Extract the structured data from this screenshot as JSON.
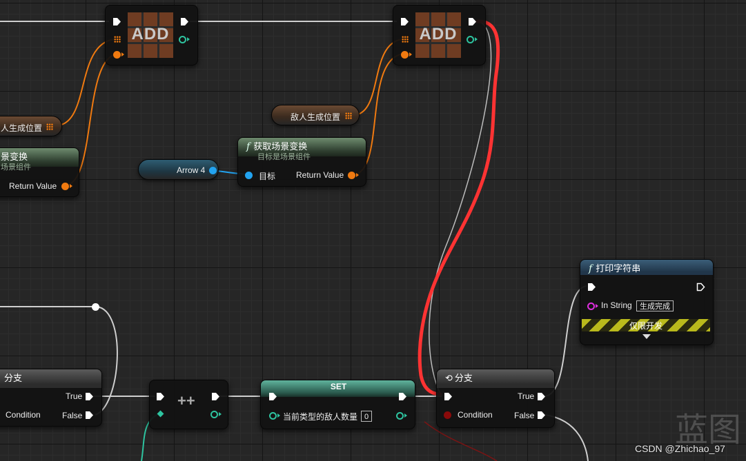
{
  "nodes": {
    "add_1": {
      "label": "ADD"
    },
    "add_2": {
      "label": "ADD"
    },
    "var_spawn_left": {
      "label": "人生成位置"
    },
    "var_spawn_right": {
      "label": "敌人生成位置"
    },
    "transform_left": {
      "title": "景变换",
      "subtitle": "场景组件",
      "output": "Return Value"
    },
    "transform_right": {
      "title": "获取场景变换",
      "subtitle": "目标是场景组件",
      "target": "目标",
      "output": "Return Value"
    },
    "arrow_var": {
      "label": "Arrow 4"
    },
    "branch_left": {
      "title": "分支",
      "condition": "Condition",
      "true_label": "True",
      "false_label": "False"
    },
    "increment": {
      "label": "++"
    },
    "set_node": {
      "title": "SET",
      "var_label": "当前类型的敌人数量",
      "value": "0"
    },
    "branch_right": {
      "title": "分支",
      "condition": "Condition",
      "true_label": "True",
      "false_label": "False"
    },
    "print_string": {
      "title": "打印字符串",
      "in_string_label": "In String",
      "in_string_value": "生成完成",
      "dev_only": "仅限开发"
    }
  },
  "watermark": {
    "text": "蓝图",
    "credit": "CSDN @Zhichao_97"
  },
  "colors": {
    "exec": "#ffffff",
    "transform": "#f07a10",
    "object": "#22a3f0",
    "integer": "#2ec4a0",
    "string": "#e02ee0",
    "bool": "#8a0a0a",
    "annotation": "#ff3333"
  }
}
